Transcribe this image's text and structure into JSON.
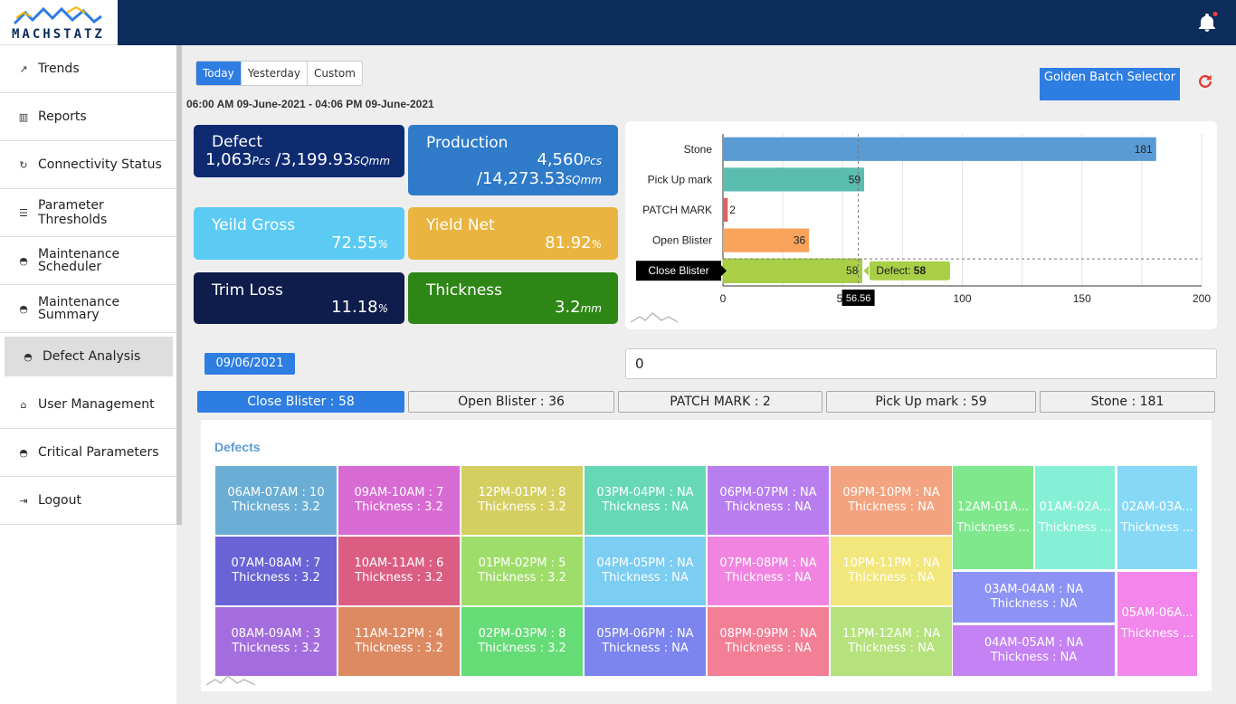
{
  "app": {
    "logo": "MACHSTATZ"
  },
  "sidebar": {
    "items": [
      {
        "label": "Trends",
        "icon": "trend-icon"
      },
      {
        "label": "Reports",
        "icon": "reports-icon"
      },
      {
        "label": "Connectivity Status",
        "icon": "connectivity-icon"
      },
      {
        "label": "Parameter Thresholds",
        "icon": "list-icon"
      },
      {
        "label": "Maintenance Scheduler",
        "icon": "helmet-icon"
      },
      {
        "label": "Maintenance Summary",
        "icon": "helmet-icon"
      },
      {
        "label": "Defect Analysis",
        "icon": "helmet-icon"
      },
      {
        "label": "User Management",
        "icon": "home-icon"
      },
      {
        "label": "Critical Parameters",
        "icon": "helmet-icon"
      },
      {
        "label": "Logout",
        "icon": "logout-icon"
      }
    ]
  },
  "filter": {
    "today": "Today",
    "yesterday": "Yesterday",
    "custom": "Custom"
  },
  "range_text": "06:00 AM 09-June-2021 - 04:06 PM 09-June-2021",
  "golden_batch": "Golden Batch Selector",
  "cards": {
    "defect": {
      "title": "Defect",
      "pcs": "1,063",
      "pcs_unit": "Pcs",
      "area": "/3,199.93",
      "area_unit": "SQmm"
    },
    "production": {
      "title": "Production",
      "pcs": "4,560",
      "pcs_unit": "Pcs",
      "area": "/14,273.53",
      "area_unit": "SQmm"
    },
    "yield_gross": {
      "title": "Yeild Gross",
      "value": "72.55",
      "unit": "%"
    },
    "yield_net": {
      "title": "Yield Net",
      "value": "81.92",
      "unit": "%"
    },
    "trim_loss": {
      "title": "Trim Loss",
      "value": "11.18",
      "unit": "%"
    },
    "thickness": {
      "title": "Thickness",
      "value": "3.2",
      "unit": "mm"
    }
  },
  "chart_data": {
    "type": "bar",
    "orientation": "horizontal",
    "categories": [
      "Stone",
      "Pick Up mark",
      "PATCH MARK",
      "Open Blister",
      "Close Blister"
    ],
    "values": [
      181,
      59,
      2,
      36,
      58
    ],
    "colors": [
      "#5b9bd5",
      "#5bbcb0",
      "#e06060",
      "#f7a35c",
      "#a8cf45"
    ],
    "xlim": [
      0,
      200
    ],
    "xticks": [
      "0",
      "50",
      "100",
      "150",
      "200"
    ],
    "crosshair_label": "56.56",
    "tooltip": {
      "category": "Close Blister",
      "label": "Defect:",
      "value": "58"
    }
  },
  "date_badge": "09/06/2021",
  "input_value": "0",
  "defect_tabs": [
    "Close Blister : 58",
    "Open Blister : 36",
    "PATCH MARK : 2",
    "Pick Up mark : 59",
    "Stone : 181"
  ],
  "defects_title": "Defects",
  "treemap": [
    {
      "l1": "06AM-07AM : 10",
      "l2": "Thickness : 3.2",
      "color": "#6aaed6"
    },
    {
      "l1": "09AM-10AM : 7",
      "l2": "Thickness : 3.2",
      "color": "#d86ad3"
    },
    {
      "l1": "12PM-01PM : 8",
      "l2": "Thickness : 3.2",
      "color": "#d5cf62"
    },
    {
      "l1": "03PM-04PM : NA",
      "l2": "Thickness : NA",
      "color": "#66d8b6"
    },
    {
      "l1": "06PM-07PM : NA",
      "l2": "Thickness : NA",
      "color": "#b87ef0"
    },
    {
      "l1": "09PM-10PM : NA",
      "l2": "Thickness : NA",
      "color": "#f3a37f"
    },
    {
      "l1": "07AM-08AM : 7",
      "l2": "Thickness : 3.2",
      "color": "#6a63d6"
    },
    {
      "l1": "10AM-11AM : 6",
      "l2": "Thickness : 3.2",
      "color": "#db5e82"
    },
    {
      "l1": "01PM-02PM : 5",
      "l2": "Thickness : 3.2",
      "color": "#9fdd6a"
    },
    {
      "l1": "04PM-05PM : NA",
      "l2": "Thickness : NA",
      "color": "#7ccdf2"
    },
    {
      "l1": "07PM-08PM : NA",
      "l2": "Thickness : NA",
      "color": "#f184e0"
    },
    {
      "l1": "10PM-11PM : NA",
      "l2": "Thickness : NA",
      "color": "#f2e77c"
    },
    {
      "l1": "08AM-09AM : 3",
      "l2": "Thickness : 3.2",
      "color": "#a46ddd"
    },
    {
      "l1": "11AM-12PM : 4",
      "l2": "Thickness : 3.2",
      "color": "#dd8a62"
    },
    {
      "l1": "02PM-03PM : 8",
      "l2": "Thickness : 3.2",
      "color": "#66dc77"
    },
    {
      "l1": "05PM-06PM : NA",
      "l2": "Thickness : NA",
      "color": "#7c84ee"
    },
    {
      "l1": "08PM-09PM : NA",
      "l2": "Thickness : NA",
      "color": "#f27f96"
    },
    {
      "l1": "11PM-12AM : NA",
      "l2": "Thickness : NA",
      "color": "#b5e27c"
    },
    {
      "l1": "12AM-01A...",
      "l2": "Thickness ...",
      "color": "#7fe88c"
    },
    {
      "l1": "01AM-02A...",
      "l2": "Thickness ...",
      "color": "#86f0d6"
    },
    {
      "l1": "02AM-03A...",
      "l2": "Thickness ...",
      "color": "#86d8f6"
    },
    {
      "l1": "03AM-04AM : NA",
      "l2": "Thickness : NA",
      "color": "#8c93f4"
    },
    {
      "l1": "04AM-05AM : NA",
      "l2": "Thickness : NA",
      "color": "#c482f4"
    },
    {
      "l1": "05AM-06A...",
      "l2": "Thickness ...",
      "color": "#f286ea"
    }
  ]
}
